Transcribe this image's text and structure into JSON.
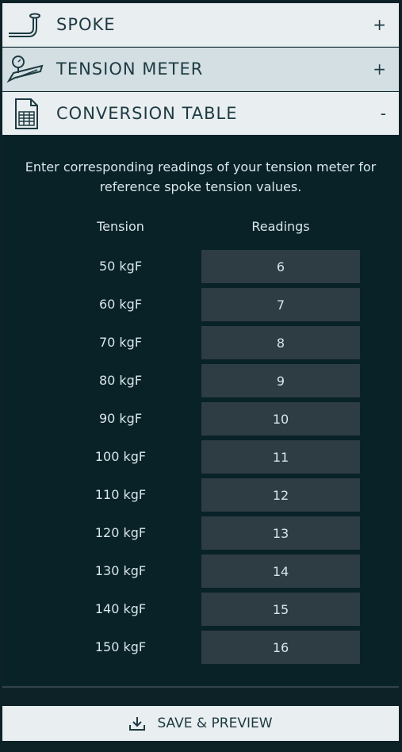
{
  "accordion": {
    "spoke": {
      "title": "SPOKE",
      "toggle": "+",
      "icon": "spoke-icon"
    },
    "tension_meter": {
      "title": "TENSION METER",
      "toggle": "+",
      "icon": "tension-meter-icon"
    },
    "conversion_table": {
      "title": "CONVERSION TABLE",
      "toggle": "-",
      "icon": "spreadsheet-icon"
    }
  },
  "conversion": {
    "description": "Enter corresponding readings of your tension meter for reference spoke tension values.",
    "headers": {
      "tension": "Tension",
      "readings": "Readings"
    },
    "rows": [
      {
        "tension": "50 kgF",
        "reading": "6"
      },
      {
        "tension": "60 kgF",
        "reading": "7"
      },
      {
        "tension": "70 kgF",
        "reading": "8"
      },
      {
        "tension": "80 kgF",
        "reading": "9"
      },
      {
        "tension": "90 kgF",
        "reading": "10"
      },
      {
        "tension": "100 kgF",
        "reading": "11"
      },
      {
        "tension": "110 kgF",
        "reading": "12"
      },
      {
        "tension": "120 kgF",
        "reading": "13"
      },
      {
        "tension": "130 kgF",
        "reading": "14"
      },
      {
        "tension": "140 kgF",
        "reading": "15"
      },
      {
        "tension": "150 kgF",
        "reading": "16"
      }
    ]
  },
  "save_button": {
    "label": "SAVE & PREVIEW",
    "icon": "download-icon"
  },
  "colors": {
    "background": "#0d2227",
    "panel": "#082228",
    "input_bg": "#2e3c43",
    "header_light": "#e9eef0",
    "header_active": "#d3dfe2",
    "text_dark": "#1d3a42",
    "text_light": "#d9e6ea"
  }
}
